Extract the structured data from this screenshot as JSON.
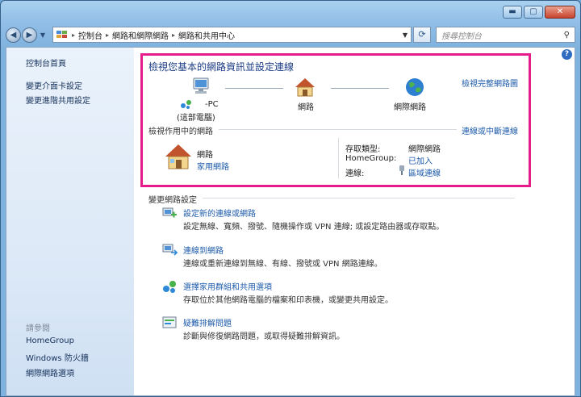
{
  "window": {
    "caption_buttons": [
      "▬",
      "▢",
      "✕"
    ]
  },
  "navigation": {
    "back_icon": "◀",
    "forward_icon": "▶",
    "breadcrumb": [
      "控制台",
      "網路和網際網路",
      "網路和共用中心"
    ],
    "search_placeholder": "搜尋控制台"
  },
  "sidebar": {
    "home": "控制台首頁",
    "links": [
      "變更介面卡設定",
      "變更進階共用設定"
    ],
    "see_also_heading": "請參閱",
    "see_also": [
      "HomeGroup",
      "Windows 防火牆",
      "網際網路選項"
    ]
  },
  "overview": {
    "title": "檢視您基本的網路資訊並設定連線",
    "view_full_map": "檢視完整網路圖",
    "computer_name": "-PC",
    "computer_caption": "(這部電腦)",
    "network_node": "網路",
    "internet_node": "網際網路"
  },
  "active_networks": {
    "heading": "檢視作用中的網路",
    "connect_link": "連線或中斷連線",
    "network_name": "網路",
    "network_type": "家用網路",
    "access_type_label": "存取類型:",
    "access_type_value": "網際網路",
    "homegroup_label": "HomeGroup:",
    "homegroup_value": "已加入",
    "connections_label": "連線:",
    "connections_value": "區域連線"
  },
  "change_settings": {
    "heading": "變更網路設定",
    "tasks": [
      {
        "link": "設定新的連線或網路",
        "desc": "設定無線、寬頻、撥號、隨機操作或 VPN 連線; 或設定路由器或存取點。"
      },
      {
        "link": "連線到網路",
        "desc": "連線或重新連線到無線、有線、撥號或 VPN 網路連線。"
      },
      {
        "link": "選擇家用群組和共用選項",
        "desc": "存取位於其他網路電腦的檔案和印表機，或變更共用設定。"
      },
      {
        "link": "疑難排解問題",
        "desc": "診斷與修復網路問題，或取得疑難排解資訊。"
      }
    ]
  },
  "colors": {
    "highlight_border": "#e61b8c",
    "link": "#1e5bab",
    "title": "#1b3d86"
  }
}
